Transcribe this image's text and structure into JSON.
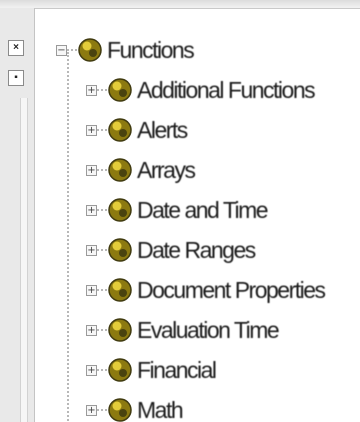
{
  "tree": {
    "root": {
      "label": "Functions",
      "toggle": "−",
      "icon": "function-folder-icon"
    },
    "children": [
      {
        "label": "Additional Functions",
        "toggle": "+"
      },
      {
        "label": "Alerts",
        "toggle": "+"
      },
      {
        "label": "Arrays",
        "toggle": "+"
      },
      {
        "label": "Date and Time",
        "toggle": "+"
      },
      {
        "label": "Date Ranges",
        "toggle": "+"
      },
      {
        "label": "Document Properties",
        "toggle": "+"
      },
      {
        "label": "Evaluation Time",
        "toggle": "+"
      },
      {
        "label": "Financial",
        "toggle": "+"
      },
      {
        "label": "Math",
        "toggle": "+"
      }
    ]
  },
  "rail": {
    "button_1": "×",
    "button_2": "▪"
  },
  "colors": {
    "icon_fill": "#8c7a10",
    "icon_highlight": "#e3cc3a",
    "icon_dark": "#3f3a10"
  }
}
